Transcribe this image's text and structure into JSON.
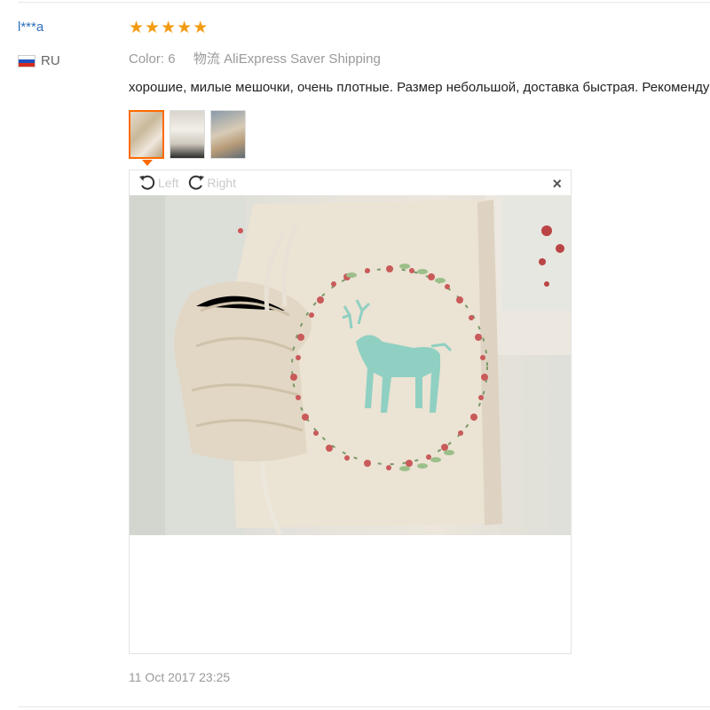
{
  "review": {
    "user_name": "l***a",
    "country_code": "RU",
    "flag_colors": [
      "#ffffff",
      "#1f4fbf",
      "#d52b1e"
    ],
    "rating": 5,
    "stars": [
      "★",
      "★",
      "★",
      "★",
      "★"
    ],
    "star_color": "#f39c12",
    "color_label": "Color:",
    "color_value": "6",
    "shipping_label": "物流",
    "shipping_value": "AliExpress Saver Shipping",
    "text": "хорошие, милые мешочки, очень плотные. Размер небольшой, доставка быстрая. Рекомендую",
    "date": "11 Oct 2017 23:25"
  },
  "gallery": {
    "thumbnails": [
      {
        "name": "photo-1",
        "active": true
      },
      {
        "name": "photo-2",
        "active": false
      },
      {
        "name": "photo-3",
        "active": false
      }
    ],
    "active_color": "#ff6a00"
  },
  "viewer": {
    "rotate_left_label": "Left",
    "rotate_right_label": "Right",
    "close_label": "×"
  }
}
